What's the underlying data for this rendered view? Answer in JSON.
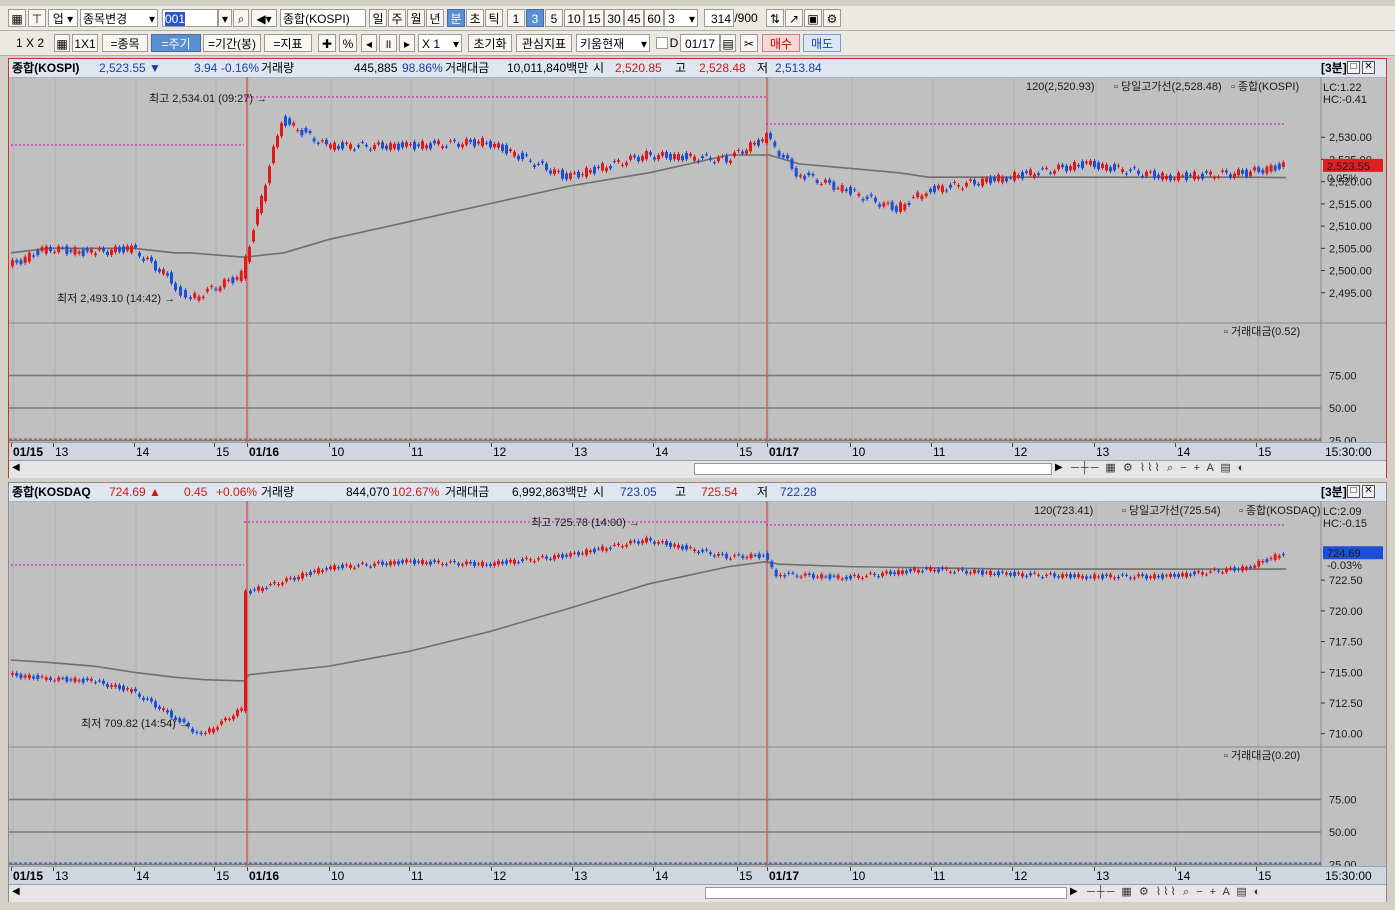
{
  "toolbar1": {
    "mode_label": "업",
    "symbol_change_label": "종목변경",
    "code_value": "001",
    "symbol_name": "종합(KOSPI)",
    "period_buttons": [
      "일",
      "주",
      "월",
      "년",
      "분",
      "초",
      "틱"
    ],
    "interval_buttons": [
      "1",
      "3",
      "5",
      "10",
      "15",
      "30",
      "45",
      "60"
    ],
    "interval_select": "3",
    "count_value": "314",
    "count_total": "/900"
  },
  "toolbar2": {
    "layout_label": "1 X 2",
    "layout_1x1": "1X1",
    "symbol_btn": "=종목",
    "period_btn": "=주기",
    "range_btn": "=기간(봉)",
    "indicator_btn": "=지표",
    "percent_label": "%",
    "zoom_label": "X 1",
    "reset_btn": "초기화",
    "interest_btn": "관심지표",
    "kiwoom_select": "키움현재",
    "checkbox_label": "D",
    "date_value": "01/17",
    "buy_btn": "매수",
    "sell_btn": "매도"
  },
  "panels": [
    {
      "name": "종합(KOSPI)",
      "price": "2,523.55",
      "change_arrow": "▼",
      "change": "3.94",
      "change_pct": "-0.16%",
      "volume_label": "거래량",
      "volume": "445,885",
      "volume_ratio": "98.86%",
      "amount_label": "거래대금",
      "amount": "10,011,840백만",
      "open_label": "시",
      "open": "2,520.85",
      "high_label": "고",
      "high": "2,528.48",
      "low_label": "저",
      "low": "2,513.84",
      "interval_tag": "[3분]",
      "ma_legend": "120(2,520.93)",
      "daily_high_legend": "당일고가선(2,528.48)",
      "series_legend": "종합(KOSPI)",
      "lc": "LC:1.22",
      "hc": "HC:-0.41",
      "current_box": "2,523.55",
      "current_pct": "0.05%",
      "max_annotation": "최고 2,534.01 (09:27)",
      "min_annotation": "최저 2,493.10 (14:42)",
      "y_ticks": [
        "2,530.00",
        "2,525.00",
        "2,520.00",
        "2,515.00",
        "2,510.00",
        "2,505.00",
        "2,500.00",
        "2,495.00"
      ],
      "sub_legend": "거래대금(0.52)",
      "sub_ticks": [
        "75.00",
        "50.00",
        "25.00"
      ],
      "time_labels": [
        "01/15",
        "13",
        "14",
        "15",
        "01/16",
        "10",
        "11",
        "12",
        "13",
        "14",
        "15",
        "01/17",
        "10",
        "11",
        "12",
        "13",
        "14",
        "15"
      ],
      "time_end": "15:30:00"
    },
    {
      "name": "종합(KOSDAQ",
      "price": "724.69",
      "change_arrow": "▲",
      "change": "0.45",
      "change_pct": "+0.06%",
      "volume_label": "거래량",
      "volume": "844,070",
      "volume_ratio": "102.67%",
      "amount_label": "거래대금",
      "amount": "6,992,863백만",
      "open_label": "시",
      "open": "723.05",
      "high_label": "고",
      "high": "725.54",
      "low_label": "저",
      "low": "722.28",
      "interval_tag": "[3분]",
      "ma_legend": "120(723.41)",
      "daily_high_legend": "당일고가선(725.54)",
      "series_legend": "종합(KOSDAQ)",
      "lc": "LC:2.09",
      "hc": "HC:-0.15",
      "current_box": "724.69",
      "current_pct": "-0.03%",
      "max_annotation": "최고 725.78 (14:00)",
      "min_annotation": "최저 709.82 (14:54)",
      "y_ticks": [
        "722.50",
        "720.00",
        "717.50",
        "715.00",
        "712.50",
        "710.00"
      ],
      "sub_legend": "거래대금(0.20)",
      "sub_ticks": [
        "75.00",
        "50.00",
        "25.00"
      ],
      "time_labels": [
        "01/15",
        "13",
        "14",
        "15",
        "01/16",
        "10",
        "11",
        "12",
        "13",
        "14",
        "15",
        "01/17",
        "10",
        "11",
        "12",
        "13",
        "14",
        "15"
      ],
      "time_end": "15:30:00"
    }
  ],
  "chart_data": [
    {
      "type": "line",
      "title": "종합(KOSPI) 3분",
      "x": [
        "01/15 12:30",
        "01/15 13:00",
        "01/15 13:30",
        "01/15 14:00",
        "01/15 14:30",
        "01/15 14:42",
        "01/15 15:30",
        "01/16 09:27",
        "01/16 10:00",
        "01/16 11:00",
        "01/16 12:00",
        "01/16 13:00",
        "01/16 14:00",
        "01/16 15:00",
        "01/16 15:30",
        "01/17 09:10",
        "01/17 10:00",
        "01/17 10:40",
        "01/17 11:00",
        "01/17 12:00",
        "01/17 13:00",
        "01/17 14:00",
        "01/17 15:00",
        "01/17 15:20"
      ],
      "series": [
        {
          "name": "종합(KOSPI)",
          "values": [
            2501,
            2505,
            2504,
            2505,
            2498,
            2493.1,
            2499,
            2534.01,
            2528,
            2528,
            2529,
            2521,
            2526,
            2525,
            2530,
            2522,
            2518,
            2513.84,
            2518,
            2521,
            2524,
            2521,
            2522,
            2523.55
          ]
        },
        {
          "name": "120",
          "values": [
            2504,
            2505,
            2505,
            2505,
            2504,
            2504,
            2503,
            2504,
            2507,
            2511,
            2515,
            2519,
            2522,
            2526,
            2526,
            2524,
            2523,
            2522,
            2521,
            2521,
            2521,
            2521,
            2521,
            2520.93
          ]
        }
      ],
      "daily_high": 2528.48,
      "ylim": [
        2490,
        2535
      ]
    },
    {
      "type": "line",
      "title": "종합(KOSDAQ) 3분",
      "x": [
        "01/15 12:30",
        "01/15 13:00",
        "01/15 13:30",
        "01/15 14:00",
        "01/15 14:30",
        "01/15 14:54",
        "01/15 15:30",
        "01/16 09:00",
        "01/16 10:00",
        "01/16 11:00",
        "01/16 12:00",
        "01/16 13:00",
        "01/16 14:00",
        "01/16 15:00",
        "01/16 15:30",
        "01/17 09:10",
        "01/17 10:00",
        "01/17 11:00",
        "01/17 12:00",
        "01/17 13:00",
        "01/17 14:00",
        "01/17 15:00",
        "01/17 15:20"
      ],
      "series": [
        {
          "name": "종합(KOSDAQ)",
          "values": [
            714.8,
            714.5,
            714.3,
            713.5,
            711.5,
            709.82,
            712,
            721.5,
            723.5,
            724,
            723.8,
            724.5,
            725.78,
            724.4,
            724.5,
            723,
            722.7,
            723.4,
            723,
            722.8,
            722.8,
            723.5,
            724.69
          ]
        },
        {
          "name": "120",
          "values": [
            716,
            715.8,
            715.5,
            715,
            714.6,
            714.4,
            714.3,
            714.8,
            715.5,
            716.7,
            718.3,
            720.2,
            722.2,
            723.6,
            724,
            723.8,
            723.6,
            723.5,
            723.4,
            723.4,
            723.4,
            723.4,
            723.41
          ]
        }
      ],
      "daily_high": 725.54,
      "ylim": [
        709,
        726.5
      ]
    }
  ],
  "colors": {
    "up": "#e01a1a",
    "down": "#1b4fd6",
    "ma": "#6e6e6e",
    "daily_high": "#d000d0",
    "panel_bg": "#c0c0c0"
  }
}
